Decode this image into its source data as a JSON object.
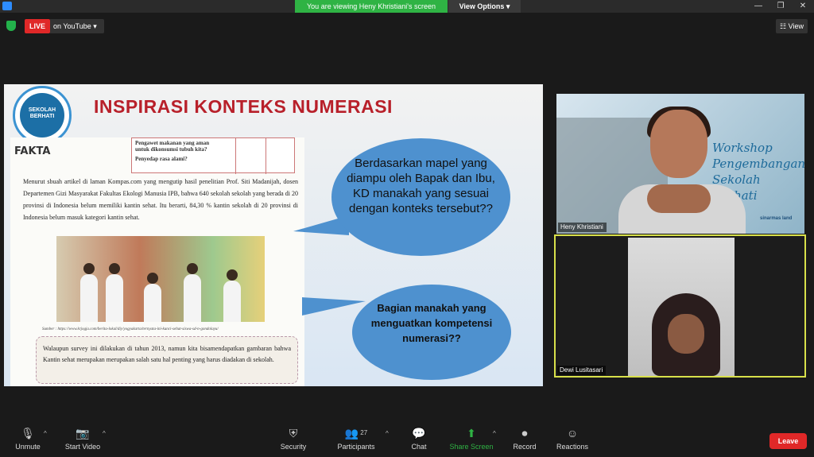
{
  "top_bar": {
    "share_banner": "You are viewing Heny Khristiani's screen",
    "view_options": "View Options ▾",
    "min": "—",
    "max": "❐",
    "close": "✕"
  },
  "stream": {
    "live_label": "LIVE",
    "youtube_label": "on YouTube ▾",
    "view_label": "☷ View"
  },
  "slide": {
    "logo_text": "SEKOLAH BERHATI",
    "title": "INSPIRASI KONTEKS NUMERASI",
    "fakta_label": "FAKTA",
    "table_rows": [
      "Pengawet makanan yang aman untuk dikonsumsi tubuh kita?",
      "Penyedap rasa alami?"
    ],
    "paragraph": "Menurut sbuah artikel di laman Kompas.com yang mengutip hasil penelitian Prof. Siti Madanijah, dosen Departemen Gizi Masyarakat Fakultas Ekologi Manusia IPB, bahwa 640 sekolah sekolah yang berada di  20 provinsi di Indonesia belum memiliki kantin sehat. Itu berarti, 84,30 % kantin sekolah di 20 provinsi di Indonesia belum masuk kategori kantin sehat.",
    "caption": "Sumber : https://www.krjogja.com/berita-lokal/diy/yogyakarta/ternyata-ini-kunci-sehat-siswa-sd-n-gondolayu/",
    "note": "Walaupun survey ini dilakukan di tahun 2013, namun kita bisamendapatkan gambaran bahwa Kantin sehat merupakan merupakan salah satu hal penting yang harus diadakan di sekolah.",
    "bubble1": "Berdasarkan mapel yang diampu oleh Bapak dan Ibu, KD manakah yang sesuai dengan konteks tersebut??",
    "bubble2": "Bagian manakah yang menguatkan kompetensi numerasi??"
  },
  "participants_tiles": [
    {
      "name": "Heny Khristiani",
      "bg_text": "Workshop Pengembangan Sekolah Berhati",
      "brand": "sinarmas land"
    },
    {
      "name": "Dewi Lusitasari"
    }
  ],
  "toolbar": {
    "unmute": "Unmute",
    "start_video": "Start Video",
    "security": "Security",
    "participants": "Participants",
    "participants_count": "27",
    "chat": "Chat",
    "share_screen": "Share Screen",
    "record": "Record",
    "reactions": "Reactions",
    "leave": "Leave"
  },
  "colors": {
    "accent_green": "#2fb344",
    "live_red": "#e02828",
    "slide_title": "#b8202a",
    "bubble": "#4e91cf",
    "active_speaker": "#d8e04a"
  }
}
